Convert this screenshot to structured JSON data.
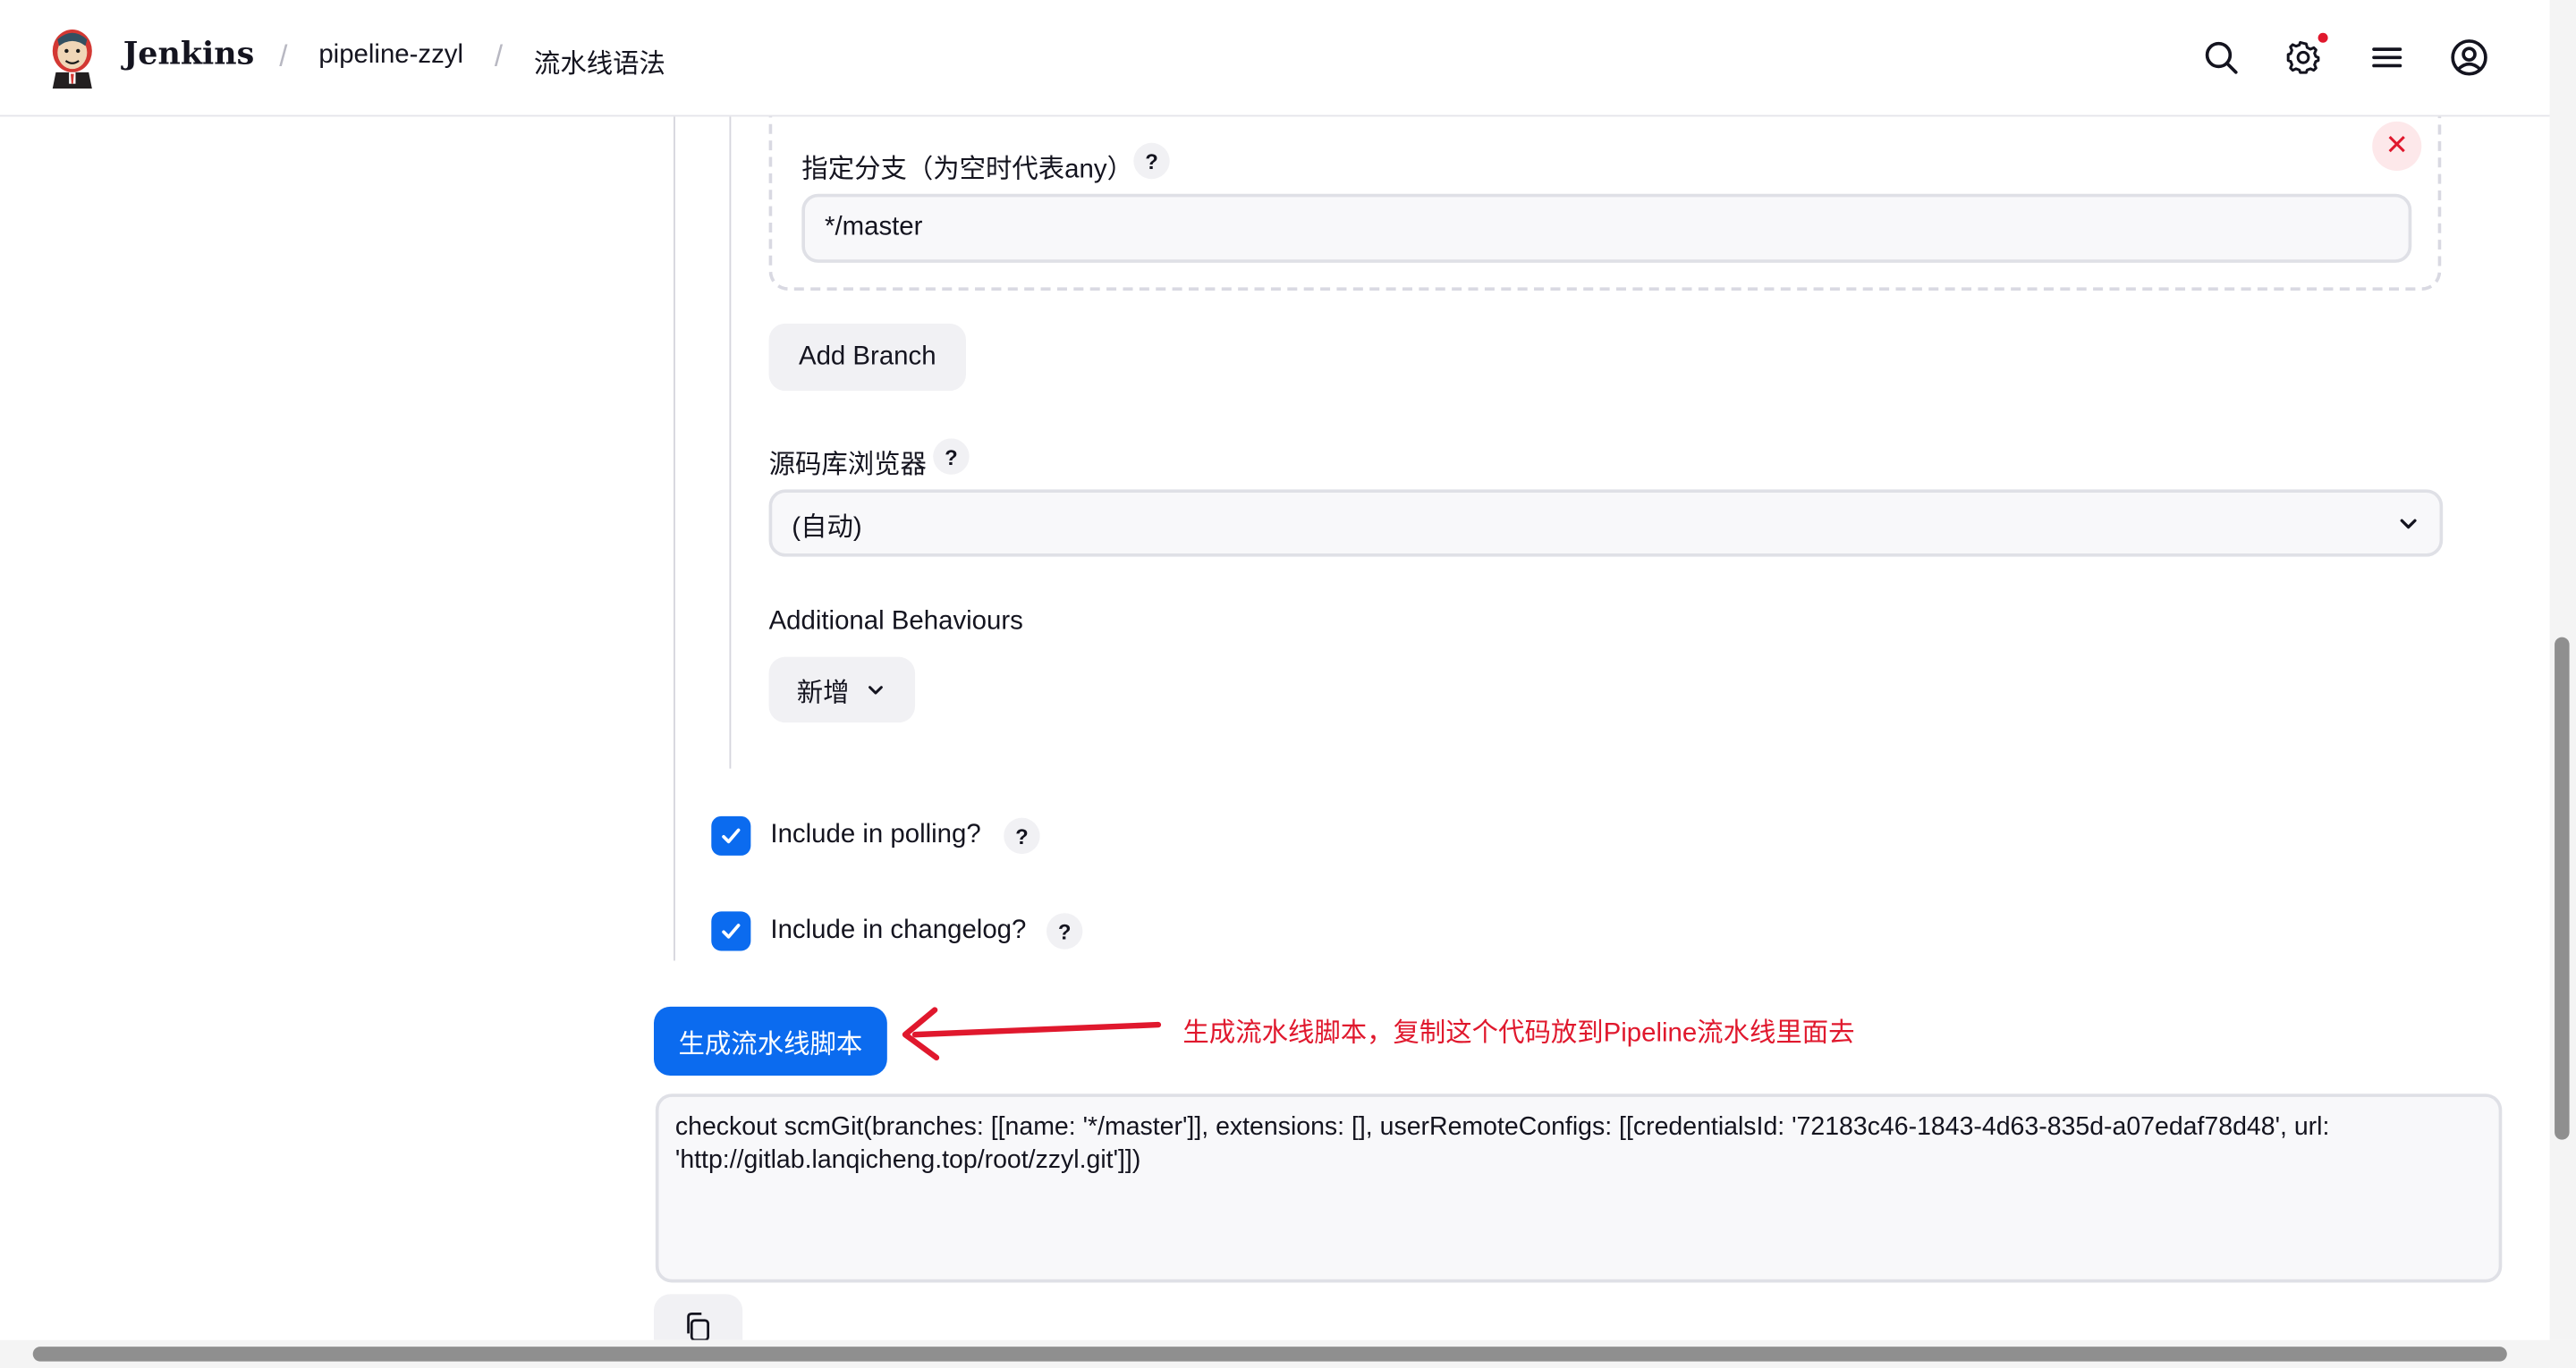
{
  "header": {
    "brand": "Jenkins",
    "crumbs": [
      "pipeline-zzyl",
      "流水线语法"
    ],
    "separator": "/"
  },
  "branch": {
    "label": "指定分支（为空时代表any）",
    "value": "*/master",
    "help": "?",
    "close": "✕"
  },
  "add_branch_label": "Add Branch",
  "repo_browser": {
    "label": "源码库浏览器",
    "help": "?",
    "value": "(自动)"
  },
  "additional_behaviours": {
    "label": "Additional Behaviours",
    "add_label": "新增"
  },
  "checks": [
    {
      "label": "Include in polling?",
      "checked": true,
      "help": "?"
    },
    {
      "label": "Include in changelog?",
      "checked": true,
      "help": "?"
    }
  ],
  "generate_button": "生成流水线脚本",
  "annotation": "生成流水线脚本，复制这个代码放到Pipeline流水线里面去",
  "script_output": "checkout scmGit(branches: [[name: '*/master']], extensions: [], userRemoteConfigs: [[credentialsId: '72183c46-1843-4d63-835d-a07edaf78d48', url:\n'http://gitlab.lanqicheng.top/root/zzyl.git']])",
  "colors": {
    "primary": "#0b6bef",
    "danger": "#e0182d",
    "text": "#14141f"
  },
  "icons": [
    "search-icon",
    "gear-icon",
    "menu-icon",
    "user-icon",
    "close-icon",
    "chevron-down-icon",
    "check-icon",
    "copy-icon"
  ]
}
